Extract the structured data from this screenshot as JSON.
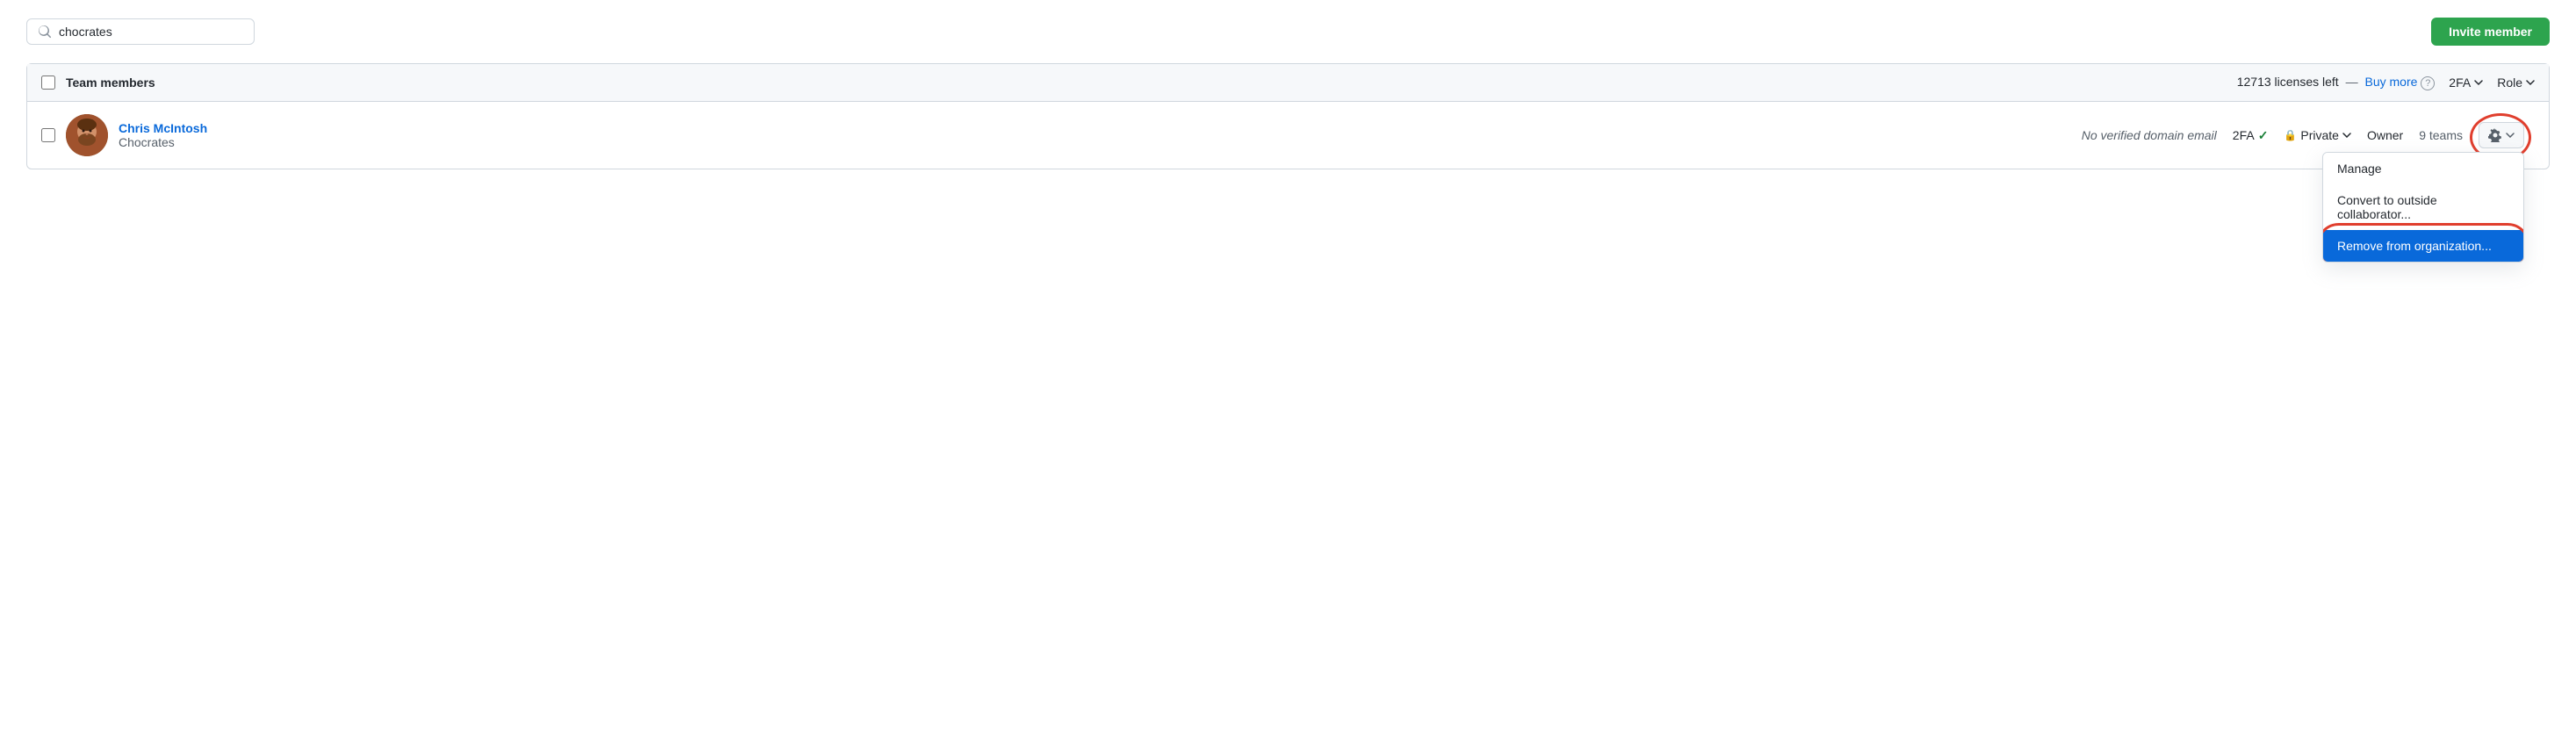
{
  "search": {
    "placeholder": "chocrates",
    "value": "chocrates"
  },
  "invite_button": {
    "label": "Invite member"
  },
  "table": {
    "header": {
      "title": "Team members",
      "licenses_text": "12713 licenses left",
      "separator": "—",
      "buy_more": "Buy more",
      "twofa_label": "2FA",
      "role_label": "Role"
    },
    "member": {
      "name": "Chris McIntosh",
      "org": "Chocrates",
      "no_email": "No verified domain email",
      "twofa": "2FA",
      "check": "✓",
      "visibility": "Private",
      "role": "Owner",
      "teams": "9 teams"
    },
    "dropdown_menu": {
      "manage": "Manage",
      "convert": "Convert to outside collaborator...",
      "remove": "Remove from organization..."
    }
  },
  "icons": {
    "search": "🔍",
    "gear": "⚙",
    "chevron": "▾",
    "lock": "🔒",
    "help": "?"
  }
}
